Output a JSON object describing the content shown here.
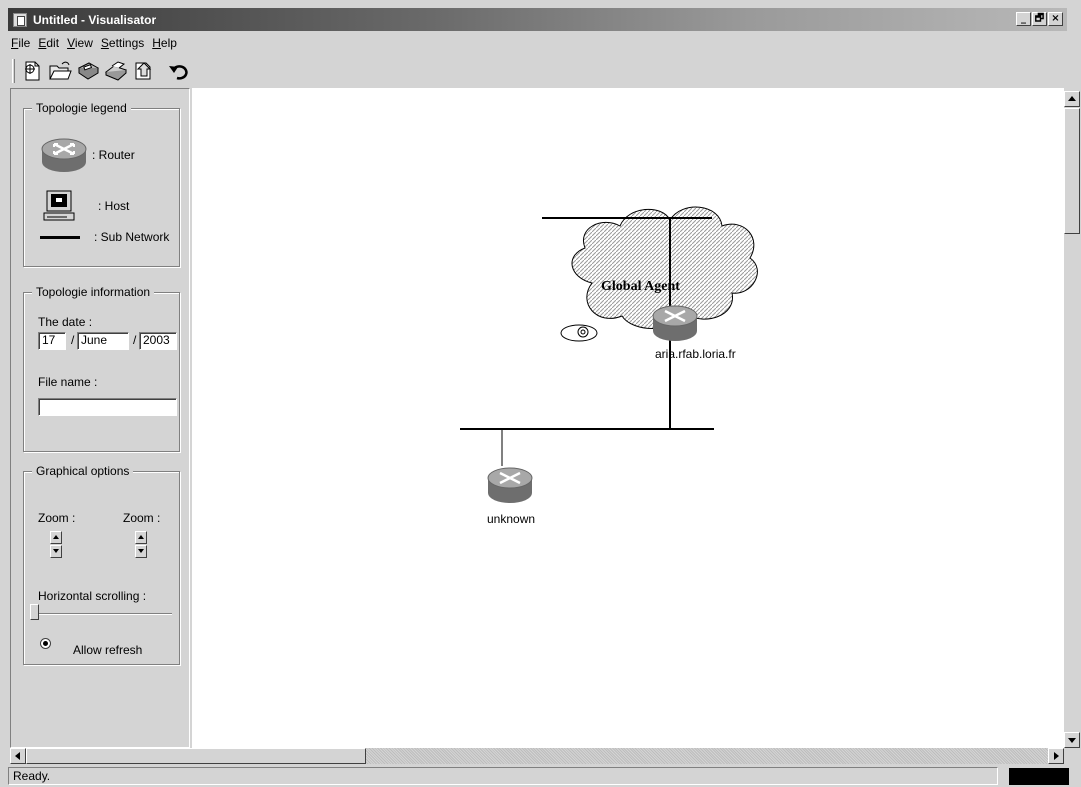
{
  "window": {
    "title": "Untitled - Visualisator",
    "buttons": [
      "_",
      "🗗",
      "×"
    ]
  },
  "menu": [
    {
      "label": "File",
      "mnemonic": "F",
      "rest": "ile"
    },
    {
      "label": "Edit",
      "mnemonic": "E",
      "rest": "dit"
    },
    {
      "label": "View",
      "mnemonic": "V",
      "rest": "iew"
    },
    {
      "label": "Settings",
      "mnemonic": "S",
      "rest": "ettings"
    },
    {
      "label": "Help",
      "mnemonic": "H",
      "rest": "elp"
    }
  ],
  "toolbar": {
    "buttons": [
      "new-icon",
      "open-icon",
      "save-icon",
      "print-icon",
      "export-icon",
      "undo-icon"
    ]
  },
  "sidebar": {
    "legend": {
      "title": "Topologie legend",
      "router": ": Router",
      "host": ": Host",
      "subnet": ": Sub Network"
    },
    "info": {
      "title": "Topologie information",
      "date_label": "The date :",
      "day": "17",
      "month": "June",
      "year": "2003",
      "sep": "/",
      "file_label": "File name :",
      "file_value": ""
    },
    "graphical": {
      "title": "Graphical options",
      "zoom1": "Zoom :",
      "zoom2": "Zoom :",
      "hscroll_label": "Horizontal scrolling :",
      "allow_refresh": "Allow refresh",
      "allow_refresh_checked": true,
      "hscroll_value": 0
    }
  },
  "canvas": {
    "agent_label": "Global Agent",
    "router_host": "aria.rfab.loria.fr",
    "router_unknown": "unknown"
  },
  "status": {
    "text": "Ready."
  }
}
